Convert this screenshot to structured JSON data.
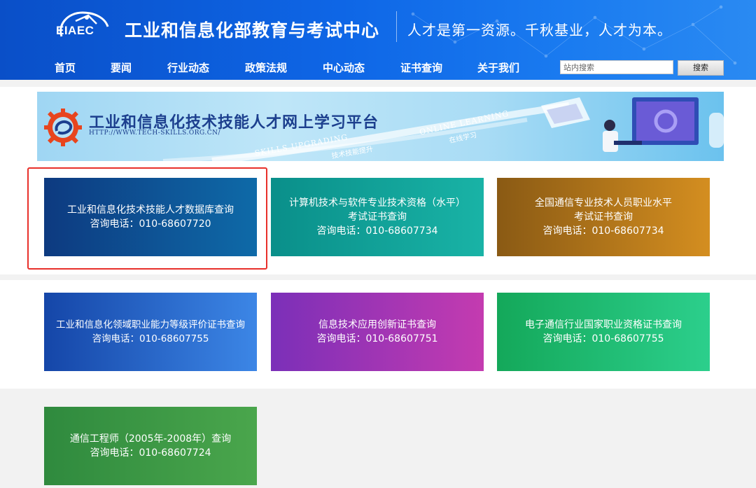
{
  "header": {
    "logo_text": "EIAEC",
    "site_title": "工业和信息化部教育与考试中心",
    "slogan": "人才是第一资源。千秋基业，人才为本。"
  },
  "nav": {
    "items": [
      {
        "label": "首页"
      },
      {
        "label": "要闻"
      },
      {
        "label": "行业动态"
      },
      {
        "label": "政策法规"
      },
      {
        "label": "中心动态"
      },
      {
        "label": "证书查询"
      },
      {
        "label": "关于我们"
      }
    ]
  },
  "search": {
    "placeholder": "站内搜索",
    "button_label": "搜索"
  },
  "banner": {
    "title": "工业和信息化技术技能人才网上学习平台",
    "url": "HTTP://WWW.TECH-SKILLS.ORG.CN/",
    "online_learning_en": "ONLINE LEARNING",
    "online_learning_cn": "在线学习",
    "skills_upgrading_en": "SKILLS UPGRADING",
    "skills_upgrading_cn": "技术技能提升"
  },
  "tiles": [
    {
      "lines": [
        "工业和信息化技术技能人才数据库查询",
        "咨询电话：010-68607720"
      ],
      "highlighted": true
    },
    {
      "lines": [
        "计算机技术与软件专业技术资格（水平）",
        "考试证书查询",
        "咨询电话：010-68607734"
      ]
    },
    {
      "lines": [
        "全国通信专业技术人员职业水平",
        "考试证书查询",
        "咨询电话：010-68607734"
      ]
    },
    {
      "lines": [
        "工业和信息化领域职业能力等级评价证书查询",
        "咨询电话：010-68607755"
      ]
    },
    {
      "lines": [
        "信息技术应用创新证书查询",
        "咨询电话：010-68607751"
      ]
    },
    {
      "lines": [
        "电子通信行业国家职业资格证书查询",
        "咨询电话：010-68607755"
      ]
    },
    {
      "lines": [
        "通信工程师（2005年-2008年）查询",
        "咨询电话：010-68607724"
      ]
    }
  ],
  "colors": {
    "header_blue": "#0e66e6",
    "highlight_red": "#e8302a"
  }
}
